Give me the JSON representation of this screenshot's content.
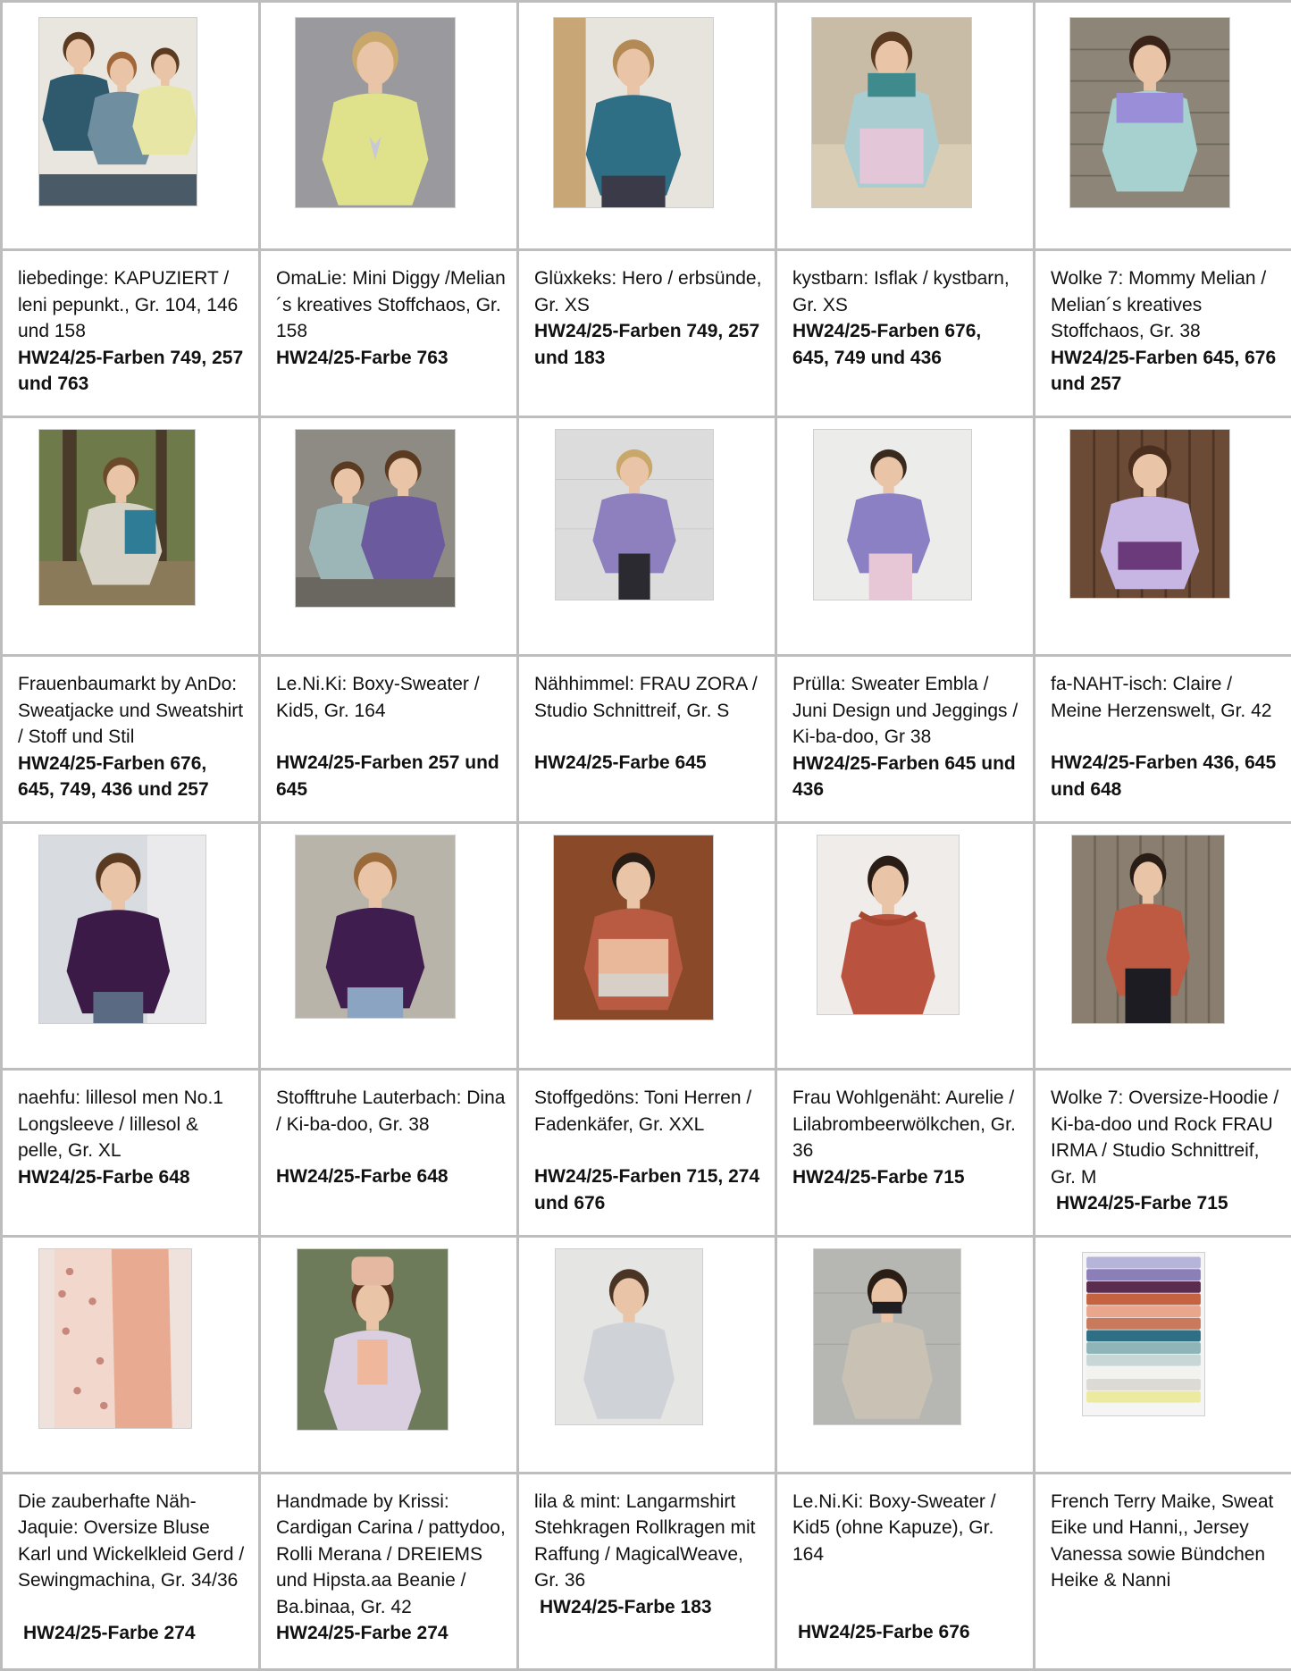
{
  "rows": [
    [
      {
        "caption": "liebedinge: KAPUZIERT / leni pepunkt., Gr. 104, 146 und 158",
        "colors": "HW24/25-Farben 749, 257 und 763",
        "photo": "three-boys-hoodies-photo"
      },
      {
        "caption": "OmaLie: Mini Diggy /Melian´s kreatives Stoffchaos, Gr. 158",
        "colors": "HW24/25-Farbe 763",
        "photo": "boy-yellow-hoodie-photo"
      },
      {
        "caption": "Glüxkeks: Hero / erbsünde, Gr. XS",
        "colors": "HW24/25-Farben 749, 257 und 183",
        "photo": "teen-teal-sweater-photo"
      },
      {
        "caption": "kystbarn: Isflak / kystbarn, Gr. XS",
        "colors": "HW24/25-Farben 676, 645, 749 und 436",
        "photo": "woman-colorblock-hoodie-photo"
      },
      {
        "caption": "Wolke 7: Mommy Melian / Melian´s kreatives Stoffchaos, Gr. 38",
        "colors": "HW24/25-Farben 645, 676 und 257",
        "photo": "woman-stone-wall-sweater-photo"
      }
    ],
    [
      {
        "caption": "Frauenbaumarkt by AnDo: Sweatjacke und Sweatshirt / Stoff und Stil",
        "colors": "HW24/25-Farben 676, 645, 749, 436 und 257",
        "photo": "woman-forest-sweatjacket-photo"
      },
      {
        "caption": "Le.Ni.Ki: Boxy-Sweater / Kid5, Gr. 164",
        "colors": "HW24/25-Farben 257 und 645",
        "photo": "two-boys-sweaters-photo"
      },
      {
        "caption": "Nähhimmel: FRAU ZORA / Studio Schnittreif, Gr. S",
        "colors": "HW24/25-Farbe 645",
        "photo": "woman-lilac-sweater-photo"
      },
      {
        "caption": "Prülla: Sweater Embla / Juni Design und Jeggings / Ki-ba-doo, Gr 38",
        "colors": "HW24/25-Farben 645 und 436",
        "photo": "woman-lilac-pink-jeggings-photo"
      },
      {
        "caption": "fa-NAHT-isch: Claire / Meine Herzenswelt, Gr. 42",
        "colors": "HW24/25-Farben 436, 645 und 648",
        "photo": "woman-wood-wall-lilac-photo"
      }
    ],
    [
      {
        "caption": "naehfu: lillesol men No.1 Longsleeve / lillesol & pelle, Gr. XL",
        "colors": "HW24/25-Farbe 648",
        "photo": "young-man-purple-longsleeve-photo"
      },
      {
        "caption": "Stofftruhe Lauterbach: Dina / Ki-ba-doo, Gr. 38",
        "colors": "HW24/25-Farbe  648",
        "photo": "woman-purple-troyer-photo"
      },
      {
        "caption": "Stoffgedöns: Toni Herren / Fadenkäfer, Gr. XXL",
        "colors": "HW24/25-Farben 715, 274 und 676",
        "photo": "man-rust-colorblock-photo"
      },
      {
        "caption": "Frau Wohlgenäht: Aurelie / Lilabrombeerwölkchen, Gr. 36",
        "colors": "HW24/25-Farbe 715",
        "photo": "woman-rust-ruffle-photo"
      },
      {
        "caption": "Wolke 7: Oversize-Hoodie / Ki-ba-doo und Rock FRAU IRMA / Studio Schnittreif, Gr. M",
        "colors": "HW24/25-Farbe 715",
        "photo": "woman-rust-hoodie-photo"
      }
    ],
    [
      {
        "caption": "Die zauberhafte Näh-Jaquie: Oversize Bluse Karl und Wickelkleid Gerd / Sewingmachina, Gr. 34/36",
        "colors": "HW24/25-Farbe 274",
        "photo": "peach-wrap-dress-photo"
      },
      {
        "caption": "Handmade by Krissi: Cardigan Carina / pattydoo, Rolli Merana / DREIEMS und Hipsta.aa Beanie / Ba.binaa, Gr. 42",
        "colors": "HW24/25-Farbe 274",
        "photo": "woman-beanie-cardigan-photo"
      },
      {
        "caption": "lila & mint: Langarmshirt Stehkragen Rollkragen mit Raffung / MagicalWeave, Gr. 36",
        "colors": "HW24/25-Farbe 183",
        "photo": "woman-grey-turtleneck-photo"
      },
      {
        "caption": "Le.Ni.Ki: Boxy-Sweater / Kid5 (ohne Kapuze), Gr. 164",
        "colors": "HW24/25-Farbe 676",
        "photo": "boy-beige-sweater-photo"
      },
      {
        "caption": " French Terry Maike, Sweat Eike und Hanni,, Jersey Vanessa sowie Bündchen Heike & Nanni",
        "colors": "",
        "photo": "fabric-stack-photo"
      }
    ]
  ]
}
